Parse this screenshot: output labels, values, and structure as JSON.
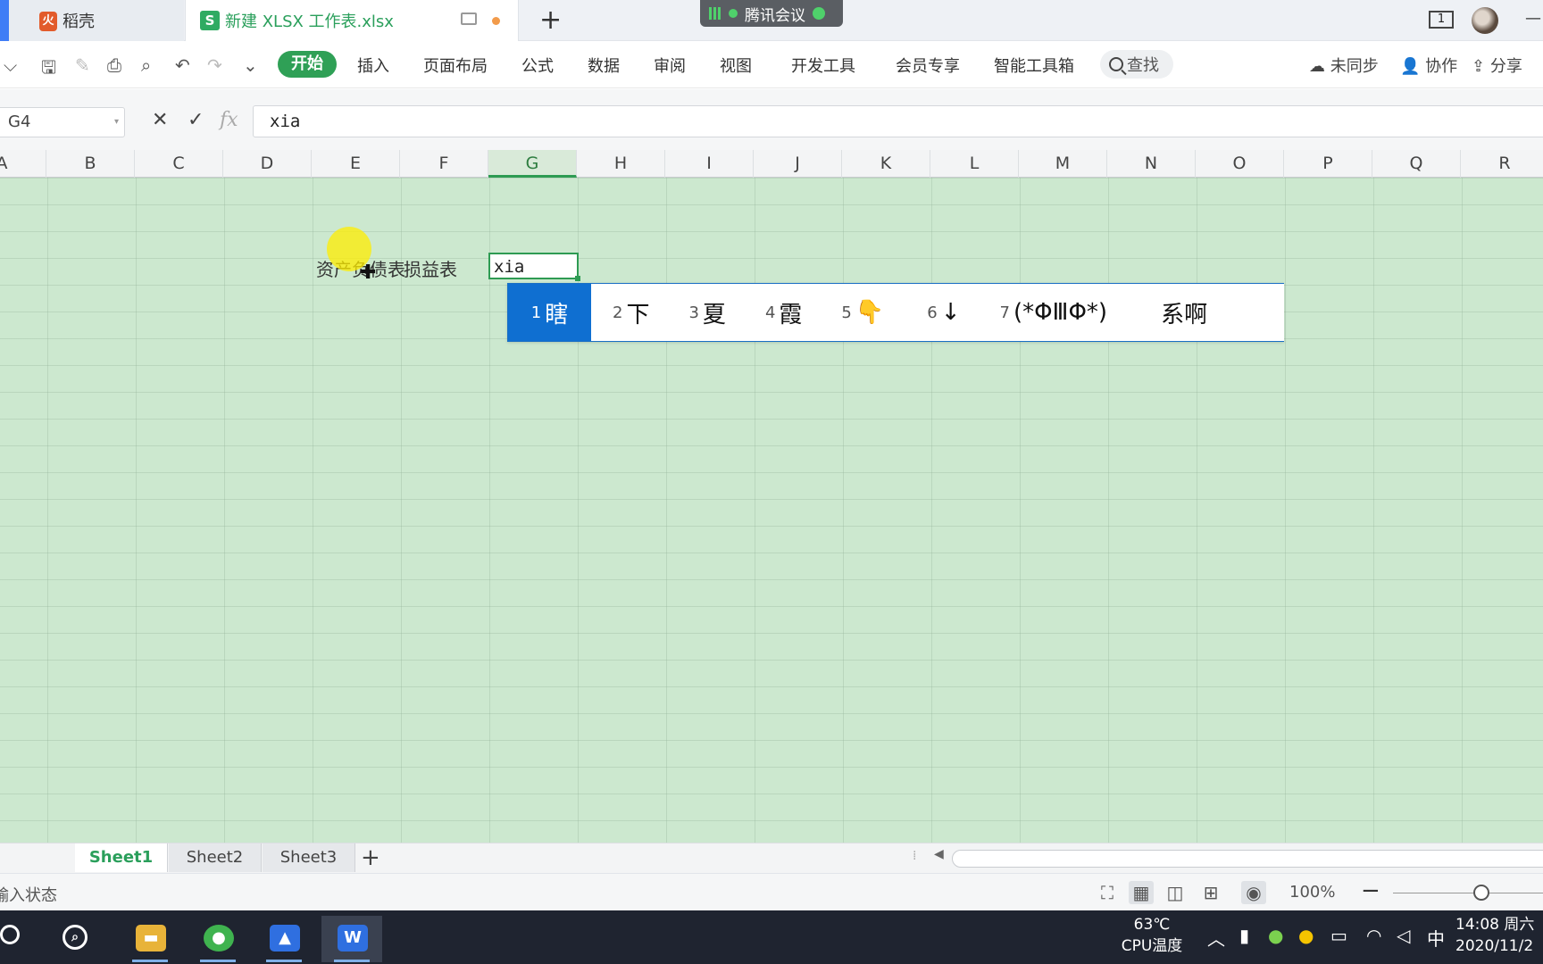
{
  "tabs": {
    "inactive_label": "稻壳",
    "active_label": "新建 XLSX 工作表.xlsx",
    "add_symbol": "+"
  },
  "meeting": {
    "label": "腾讯会议"
  },
  "window": {
    "count_badge": "1",
    "minimize_symbol": "—"
  },
  "menu": {
    "items": [
      "开始",
      "插入",
      "页面布局",
      "公式",
      "数据",
      "审阅",
      "视图",
      "开发工具",
      "会员专享",
      "智能工具箱"
    ],
    "search_label": "查找",
    "sync_label": "未同步",
    "collab_label": "协作",
    "share_label": "分享",
    "accent_color": "#2fa056"
  },
  "formula_bar": {
    "cell_ref": "G4",
    "cancel_symbol": "✕",
    "confirm_symbol": "✓",
    "fx_label": "fx",
    "formula_text": "xia"
  },
  "columns": [
    "A",
    "B",
    "C",
    "D",
    "E",
    "F",
    "G",
    "H",
    "I",
    "J",
    "K",
    "L",
    "M",
    "N",
    "O",
    "P",
    "Q",
    "R"
  ],
  "selected_column": "G",
  "cells": {
    "e4_text": "资产负债表",
    "f4_text": "损益表",
    "g4_editing": "xia"
  },
  "ime": {
    "candidates": [
      {
        "num": "1",
        "text": "瞎"
      },
      {
        "num": "2",
        "text": "下"
      },
      {
        "num": "3",
        "text": "夏"
      },
      {
        "num": "4",
        "text": "霞"
      },
      {
        "num": "5",
        "text": "👇"
      },
      {
        "num": "6",
        "text": "↓"
      },
      {
        "num": "7",
        "text": "(*ΦⅢΦ*)"
      },
      {
        "num": "",
        "text": "系啊"
      }
    ],
    "highlight_color": "#0f6fd1"
  },
  "sheets": {
    "tabs": [
      "Sheet1",
      "Sheet2",
      "Sheet3"
    ],
    "active": "Sheet1",
    "add_symbol": "+"
  },
  "status": {
    "mode_text": "输入状态",
    "zoom_label": "100%",
    "zoom_percent": 100
  },
  "taskbar": {
    "temp_value": "63℃",
    "temp_label": "CPU温度",
    "ime_lang": "中",
    "time": "14:08 周六",
    "date": "2020/11/2"
  }
}
